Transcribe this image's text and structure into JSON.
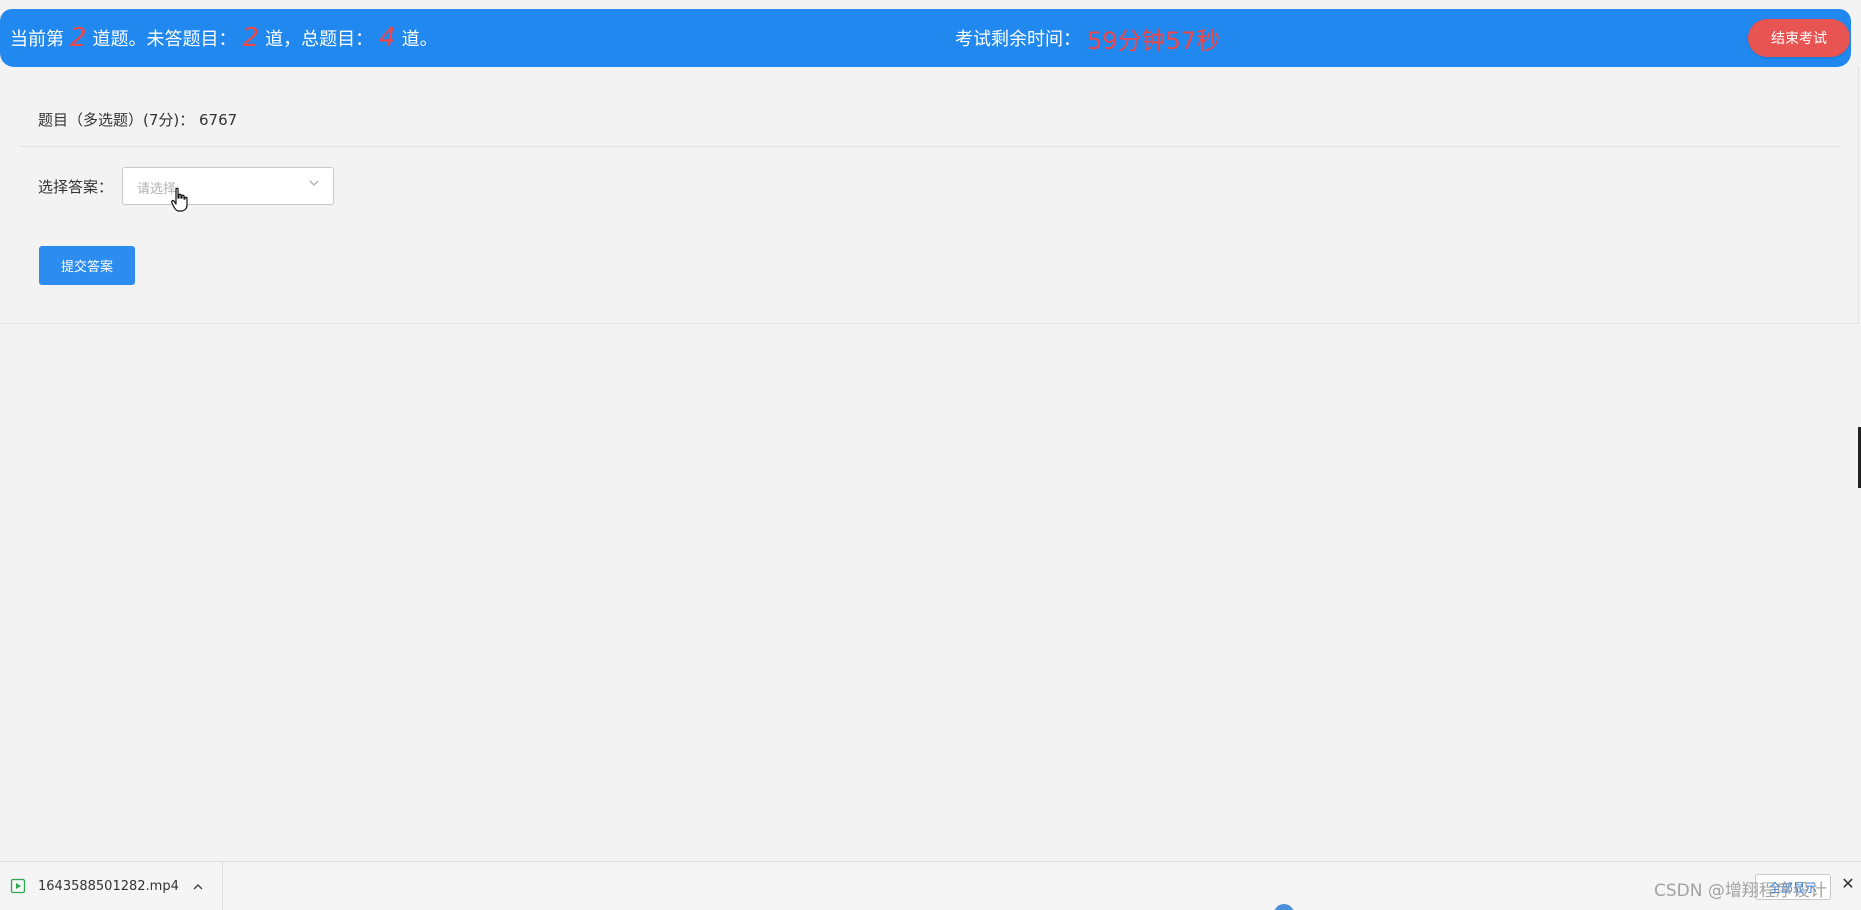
{
  "header": {
    "status_prefix": "当前第",
    "current_question": "2",
    "status_mid1": "道题。未答题目：",
    "unanswered": "2",
    "status_mid2": "道，总题目：",
    "total": "4",
    "status_suffix": "道。",
    "timer_label": "考试剩余时间：",
    "timer_value": "59分钟57秒",
    "end_button": "结束考试"
  },
  "question": {
    "title": "题目（多选题）(7分)： 6767",
    "answer_label": "选择答案：",
    "select_placeholder": "请选择",
    "submit_button": "提交答案"
  },
  "download_bar": {
    "file_name": "1643588501282.mp4",
    "show_all_button": "全部显示",
    "close_symbol": "✕"
  },
  "watermark": "CSDN @增翔程序设计",
  "colors": {
    "header_bg": "#2088ee",
    "accent_red": "#f04848",
    "end_button_bg": "#e85452",
    "submit_button_bg": "#2d8cf0",
    "page_bg": "#f3f3f3"
  },
  "icons": {
    "select_arrow": "chevron-down-icon",
    "cursor": "pointer-hand-icon",
    "file": "video-file-icon",
    "download_expand": "chevron-up-icon",
    "close": "close-icon"
  }
}
